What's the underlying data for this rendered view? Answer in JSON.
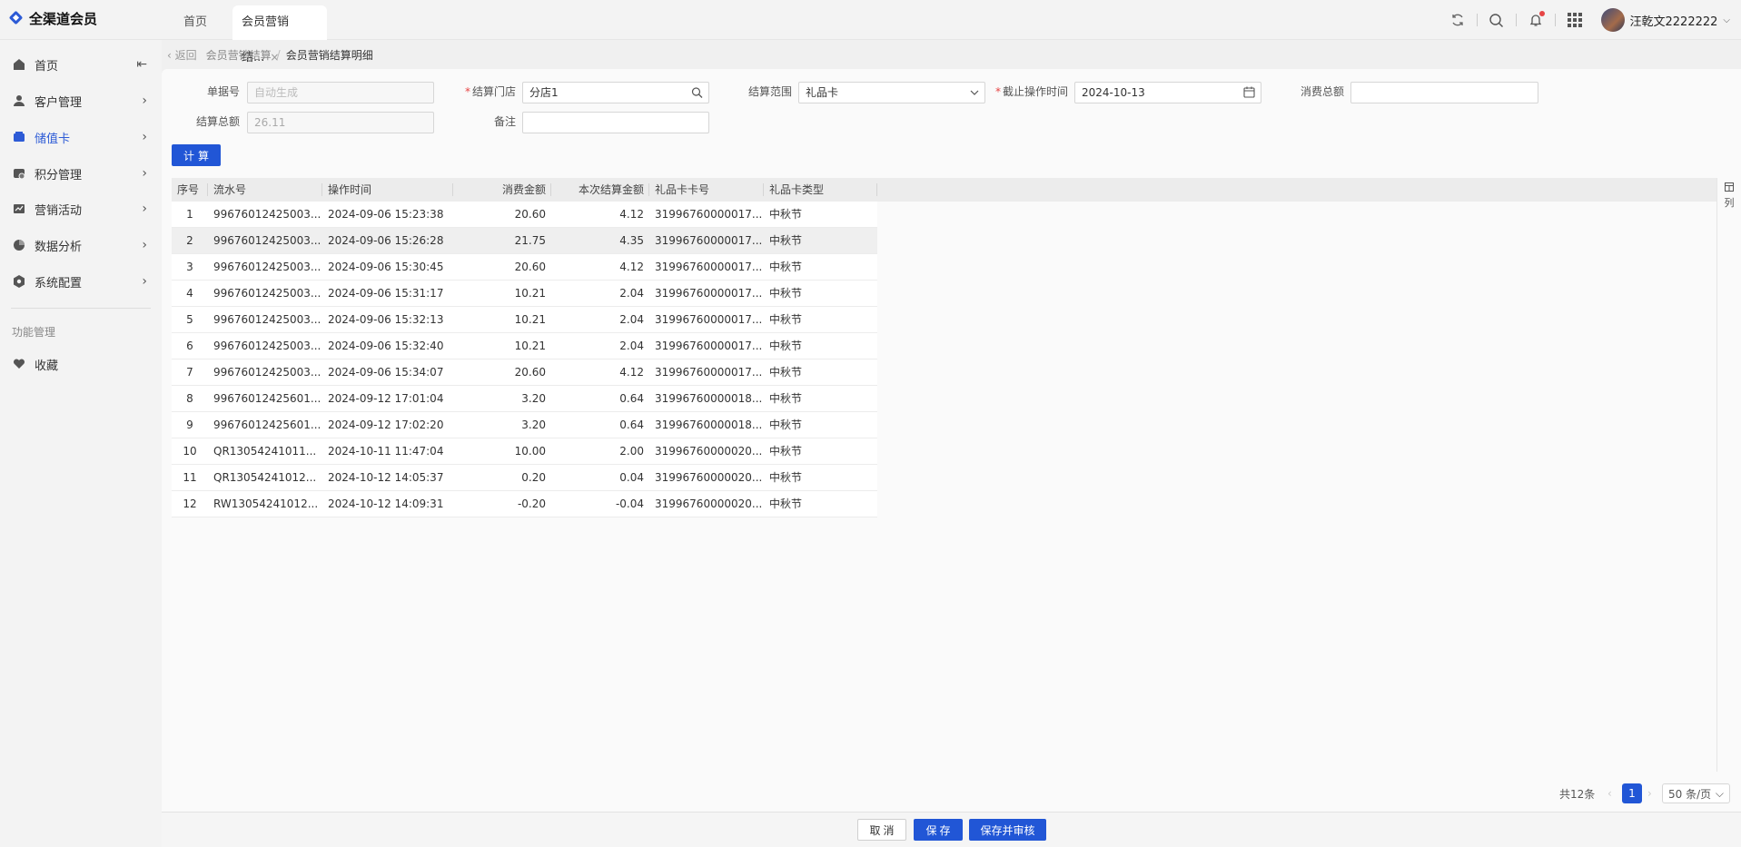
{
  "app": {
    "logo_text": "全渠道会员"
  },
  "tabs": [
    {
      "label": "首页"
    },
    {
      "label": "会员营销结...",
      "close": "×"
    }
  ],
  "user": {
    "name": "汪乾文2222222",
    "chevron": "⌵"
  },
  "sidebar": {
    "collapse_icon": "⇤",
    "items": [
      {
        "label": "首页",
        "icon": "home-icon"
      },
      {
        "label": "客户管理",
        "icon": "user-icon",
        "arrow": "›"
      },
      {
        "label": "储值卡",
        "icon": "wallet-icon",
        "arrow": "›",
        "active": true
      },
      {
        "label": "积分管理",
        "icon": "points-icon",
        "arrow": "›"
      },
      {
        "label": "营销活动",
        "icon": "chart-icon",
        "arrow": "›"
      },
      {
        "label": "数据分析",
        "icon": "pie-icon",
        "arrow": "›"
      },
      {
        "label": "系统配置",
        "icon": "settings-icon",
        "arrow": "›"
      }
    ],
    "section_title": "功能管理",
    "favorite": {
      "label": "收藏",
      "icon": "heart-icon"
    }
  },
  "breadcrumb": {
    "back": "‹  返回",
    "parent": "会员营销结算",
    "sep": "/",
    "current": "会员营销结算明细"
  },
  "form": {
    "doc_no": {
      "label": "单据号",
      "placeholder": "自动生成"
    },
    "store": {
      "label": "结算门店",
      "value": "分店1",
      "required": "*"
    },
    "scope": {
      "label": "结算范围",
      "value": "礼品卡"
    },
    "deadline": {
      "label": "截止操作时间",
      "value": "2024-10-13",
      "required": "*"
    },
    "consume_total": {
      "label": "消费总额",
      "value": ""
    },
    "settle_total": {
      "label": "结算总额",
      "value": "26.11"
    },
    "remark": {
      "label": "备注",
      "value": ""
    },
    "calc_button": "计算"
  },
  "table": {
    "columns": [
      "序号",
      "流水号",
      "操作时间",
      "消费金额",
      "本次结算金额",
      "礼品卡卡号",
      "礼品卡类型"
    ],
    "rows": [
      {
        "no": "1",
        "serial": "99676012425003...",
        "time": "2024-09-06 15:23:38",
        "amount": "20.60",
        "settle": "4.12",
        "card": "31996760000017...",
        "type": "中秋节"
      },
      {
        "no": "2",
        "serial": "99676012425003...",
        "time": "2024-09-06 15:26:28",
        "amount": "21.75",
        "settle": "4.35",
        "card": "31996760000017...",
        "type": "中秋节"
      },
      {
        "no": "3",
        "serial": "99676012425003...",
        "time": "2024-09-06 15:30:45",
        "amount": "20.60",
        "settle": "4.12",
        "card": "31996760000017...",
        "type": "中秋节"
      },
      {
        "no": "4",
        "serial": "99676012425003...",
        "time": "2024-09-06 15:31:17",
        "amount": "10.21",
        "settle": "2.04",
        "card": "31996760000017...",
        "type": "中秋节"
      },
      {
        "no": "5",
        "serial": "99676012425003...",
        "time": "2024-09-06 15:32:13",
        "amount": "10.21",
        "settle": "2.04",
        "card": "31996760000017...",
        "type": "中秋节"
      },
      {
        "no": "6",
        "serial": "99676012425003...",
        "time": "2024-09-06 15:32:40",
        "amount": "10.21",
        "settle": "2.04",
        "card": "31996760000017...",
        "type": "中秋节"
      },
      {
        "no": "7",
        "serial": "99676012425003...",
        "time": "2024-09-06 15:34:07",
        "amount": "20.60",
        "settle": "4.12",
        "card": "31996760000017...",
        "type": "中秋节"
      },
      {
        "no": "8",
        "serial": "99676012425601...",
        "time": "2024-09-12 17:01:04",
        "amount": "3.20",
        "settle": "0.64",
        "card": "31996760000018...",
        "type": "中秋节"
      },
      {
        "no": "9",
        "serial": "99676012425601...",
        "time": "2024-09-12 17:02:20",
        "amount": "3.20",
        "settle": "0.64",
        "card": "31996760000018...",
        "type": "中秋节"
      },
      {
        "no": "10",
        "serial": "QR13054241011...",
        "time": "2024-10-11 11:47:04",
        "amount": "10.00",
        "settle": "2.00",
        "card": "31996760000020...",
        "type": "中秋节"
      },
      {
        "no": "11",
        "serial": "QR13054241012...",
        "time": "2024-10-12 14:05:37",
        "amount": "0.20",
        "settle": "0.04",
        "card": "31996760000020...",
        "type": "中秋节"
      },
      {
        "no": "12",
        "serial": "RW13054241012...",
        "time": "2024-10-12 14:09:31",
        "amount": "-0.20",
        "settle": "-0.04",
        "card": "31996760000020...",
        "type": "中秋节"
      }
    ],
    "column_settings": "列"
  },
  "pagination": {
    "total": "共12条",
    "prev": "‹",
    "current": "1",
    "next": "›",
    "page_size": "50 条/页",
    "size_chevron": "⌵"
  },
  "footer": {
    "cancel": "取消",
    "save": "保存",
    "save_audit": "保存并审核"
  },
  "colors": {
    "primary": "#2156d6",
    "required": "#e64545"
  }
}
